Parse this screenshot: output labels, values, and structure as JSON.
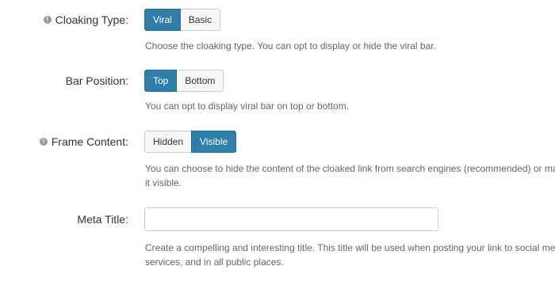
{
  "cloaking": {
    "label": "Cloaking Type:",
    "options": [
      "Viral",
      "Basic"
    ],
    "selected": "Viral",
    "help": "Choose the cloaking type. You can opt to display or hide the viral bar."
  },
  "bar_position": {
    "label": "Bar Position:",
    "options": [
      "Top",
      "Bottom"
    ],
    "selected": "Top",
    "help": "You can opt to display viral bar on top or bottom."
  },
  "frame_content": {
    "label": "Frame Content:",
    "options": [
      "Hidden",
      "Visible"
    ],
    "selected": "Visible",
    "help": "You can choose to hide the content of the cloaked link from search engines (recommended) or make it visible."
  },
  "meta_title": {
    "label": "Meta Title:",
    "value": "",
    "help": "Create a compelling and interesting title. This title will be used when posting your link to social media services, and in all public places."
  },
  "icons": {
    "info": "info-icon"
  }
}
